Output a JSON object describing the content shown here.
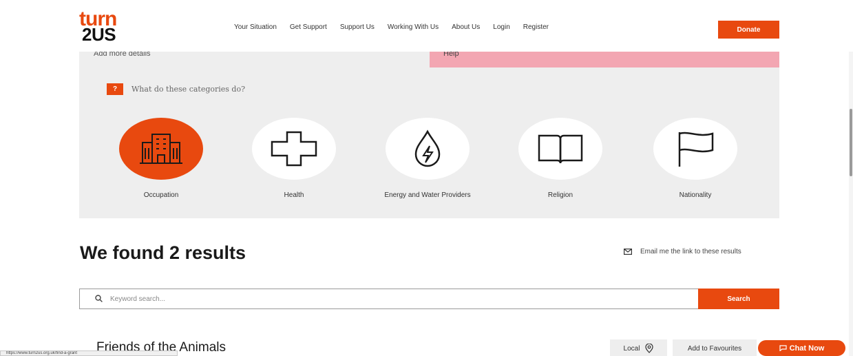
{
  "header": {
    "logo_top": "turn",
    "logo_bottom": "2US",
    "nav": [
      "Your Situation",
      "Get Support",
      "Support Us",
      "Working With Us",
      "About Us",
      "Login",
      "Register"
    ],
    "donate_label": "Donate"
  },
  "panel": {
    "left_cut_text": "Add more details",
    "right_cut_text": "Help",
    "help_badge": "?",
    "help_text": "What do these categories do?",
    "categories": [
      {
        "label": "Occupation",
        "icon": "building-icon",
        "selected": true
      },
      {
        "label": "Health",
        "icon": "cross-icon",
        "selected": false
      },
      {
        "label": "Energy and Water Providers",
        "icon": "water-energy-icon",
        "selected": false
      },
      {
        "label": "Religion",
        "icon": "book-icon",
        "selected": false
      },
      {
        "label": "Nationality",
        "icon": "flag-icon",
        "selected": false
      }
    ]
  },
  "results": {
    "title": "We found 2 results",
    "email_link": "Email me the link to these results",
    "search_placeholder": "Keyword search...",
    "search_button": "Search",
    "first_result": "Friends of the Animals",
    "local_label": "Local",
    "favourites_label": "Add to Favourites",
    "chat_label": "Chat Now"
  },
  "status_bar": {
    "url": "https://www.turn2us.org.uk/find-a-grant"
  },
  "colors": {
    "accent": "#e8490f",
    "panel": "#eeeeee",
    "pink": "#f3a6b2"
  }
}
